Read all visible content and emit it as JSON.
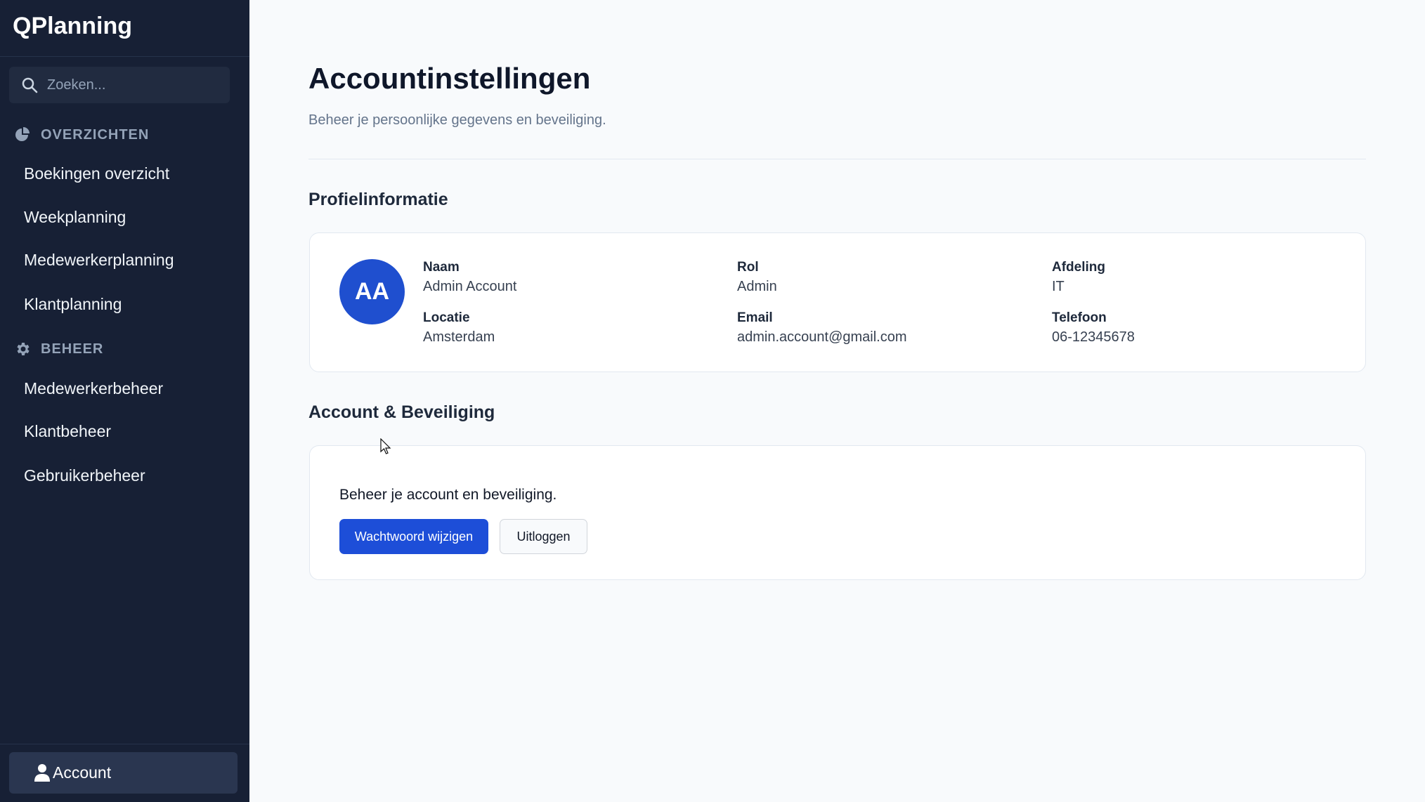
{
  "app": {
    "brand": "QPlanning"
  },
  "sidebar": {
    "search_placeholder": "Zoeken...",
    "sections": [
      {
        "title": "OVERZICHTEN",
        "icon": "chart-pie-icon"
      },
      {
        "title": "BEHEER",
        "icon": "gear-icon"
      }
    ],
    "overview_items": [
      {
        "label": "Boekingen overzicht"
      },
      {
        "label": "Weekplanning"
      },
      {
        "label": "Medewerkerplanning"
      },
      {
        "label": "Klantplanning"
      }
    ],
    "management_items": [
      {
        "label": "Medewerkerbeheer"
      },
      {
        "label": "Klantbeheer"
      },
      {
        "label": "Gebruikerbeheer"
      }
    ],
    "account": {
      "label": "Account",
      "icon": "user-icon"
    }
  },
  "main": {
    "title": "Accountinstellingen",
    "subtitle": "Beheer je persoonlijke gegevens en beveiliging.",
    "profile": {
      "section_title": "Profielinformatie",
      "avatar_initials": "AA",
      "fields": {
        "name": {
          "label": "Naam",
          "value": "Admin Account"
        },
        "role": {
          "label": "Rol",
          "value": "Admin"
        },
        "department": {
          "label": "Afdeling",
          "value": "IT"
        },
        "location": {
          "label": "Locatie",
          "value": "Amsterdam"
        },
        "email": {
          "label": "Email",
          "value": "admin.account@gmail.com"
        },
        "phone": {
          "label": "Telefoon",
          "value": "06-12345678"
        }
      }
    },
    "security": {
      "section_title": "Account & Beveiliging",
      "description": "Beheer je account en beveiliging.",
      "change_password_label": "Wachtwoord wijzigen",
      "logout_label": "Uitloggen"
    }
  },
  "colors": {
    "sidebar_bg": "#172035",
    "accent": "#1d4ed8",
    "page_bg": "#f8fafc"
  }
}
